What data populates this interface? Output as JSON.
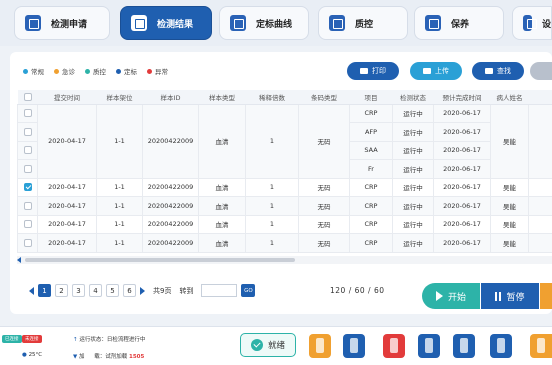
{
  "nav": {
    "items": [
      {
        "label": "检测申请",
        "active": false
      },
      {
        "label": "检测结果",
        "active": true
      },
      {
        "label": "定标曲线",
        "active": false
      },
      {
        "label": "质控",
        "active": false
      },
      {
        "label": "保养",
        "active": false
      },
      {
        "label": "设",
        "active": false
      }
    ]
  },
  "legend": [
    {
      "label": "常规",
      "color": "#2aa0d6"
    },
    {
      "label": "急诊",
      "color": "#f0a030"
    },
    {
      "label": "质控",
      "color": "#2db3a8"
    },
    {
      "label": "定标",
      "color": "#1f5fb0"
    },
    {
      "label": "异常",
      "color": "#e23b3b"
    }
  ],
  "actions": {
    "print": "打印",
    "upload": "上传",
    "search": "查找"
  },
  "table": {
    "headers": [
      "提交时间",
      "样本架位",
      "样本ID",
      "样本类型",
      "稀释倍数",
      "条码类型",
      "项目",
      "检测状态",
      "预计完成时间",
      "病人姓名"
    ],
    "group": {
      "time": "2020-04-17",
      "rack": "1-1",
      "id": "20200422009",
      "type": "血清",
      "dilution": "1",
      "barcode": "无码",
      "patient": "吴能",
      "items": [
        {
          "item": "CRP",
          "status": "运行中",
          "eta": "2020-06-17"
        },
        {
          "item": "AFP",
          "status": "运行中",
          "eta": "2020-06-17"
        },
        {
          "item": "SAA",
          "status": "运行中",
          "eta": "2020-06-17"
        },
        {
          "item": "Fr",
          "status": "运行中",
          "eta": "2020-06-17"
        }
      ]
    },
    "rows": [
      {
        "checked": true,
        "time": "2020-04-17",
        "rack": "1-1",
        "id": "20200422009",
        "type": "血清",
        "dilution": "1",
        "barcode": "无码",
        "item": "CRP",
        "status": "运行中",
        "eta": "2020-06-17",
        "patient": "吴能"
      },
      {
        "checked": false,
        "time": "2020-04-17",
        "rack": "1-1",
        "id": "20200422009",
        "type": "血清",
        "dilution": "1",
        "barcode": "无码",
        "item": "CRP",
        "status": "运行中",
        "eta": "2020-06-17",
        "patient": "吴能"
      },
      {
        "checked": false,
        "time": "2020-04-17",
        "rack": "1-1",
        "id": "20200422009",
        "type": "血清",
        "dilution": "1",
        "barcode": "无码",
        "item": "CRP",
        "status": "运行中",
        "eta": "2020-06-17",
        "patient": "吴能"
      },
      {
        "checked": false,
        "time": "2020-04-17",
        "rack": "1-1",
        "id": "20200422009",
        "type": "血清",
        "dilution": "1",
        "barcode": "无码",
        "item": "CRP",
        "status": "运行中",
        "eta": "2020-06-17",
        "patient": "吴能"
      }
    ]
  },
  "pagination": {
    "pages": [
      "1",
      "2",
      "3",
      "4",
      "5",
      "6"
    ],
    "current": "1",
    "total": "共9页",
    "goto": "转到",
    "go": "GO",
    "counts": "120 / 60 / 60"
  },
  "controls": {
    "start": "开始",
    "pause": "暂停"
  },
  "status": {
    "tag_connected": "已连接",
    "tag_disconnected": "未连接",
    "run_label": "运行状态：",
    "run_value": "日检流程进行中",
    "temp": "25°C",
    "load_label": "加",
    "load_label2": "载：",
    "load_value_label": "试剂加载",
    "load_value": "1505",
    "ready": "就绪"
  },
  "reagents": [
    {
      "color": "#f0a030"
    },
    {
      "color": "#1f5fb0"
    },
    {
      "color": "#e23b3b"
    },
    {
      "color": "#1f5fb0"
    },
    {
      "color": "#1f5fb0"
    },
    {
      "color": "#1f5fb0"
    },
    {
      "color": "#e08a1e"
    },
    {
      "color": "#f0a030"
    }
  ]
}
